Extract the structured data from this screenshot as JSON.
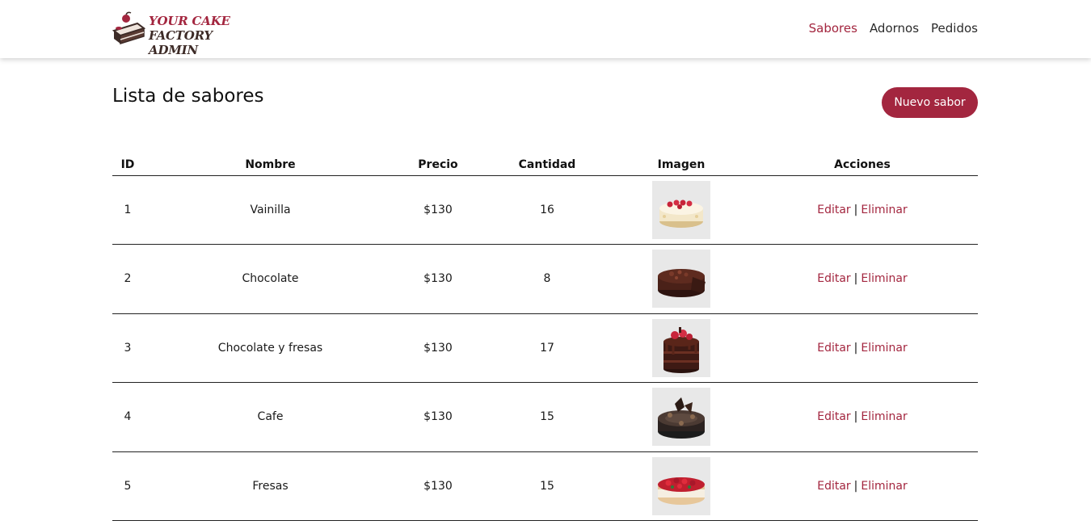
{
  "app": {
    "logo_line1": "YOUR CAKE",
    "logo_line2": "FACTORY ADMIN",
    "brand_color": "#a3263f"
  },
  "nav": {
    "items": [
      {
        "label": "Sabores",
        "active": true
      },
      {
        "label": "Adornos",
        "active": false
      },
      {
        "label": "Pedidos",
        "active": false
      }
    ]
  },
  "page": {
    "title": "Lista de sabores",
    "new_button": "Nuevo sabor"
  },
  "table": {
    "headers": [
      "ID",
      "Nombre",
      "Precio",
      "Cantidad",
      "Imagen",
      "Acciones"
    ],
    "rows": [
      {
        "id": "1",
        "name": "Vainilla",
        "price": "$130",
        "qty": "16",
        "image_icon": "vanilla-cake-image"
      },
      {
        "id": "2",
        "name": "Chocolate",
        "price": "$130",
        "qty": "8",
        "image_icon": "chocolate-cake-image"
      },
      {
        "id": "3",
        "name": "Chocolate y fresas",
        "price": "$130",
        "qty": "17",
        "image_icon": "chocolate-strawberry-cake-image"
      },
      {
        "id": "4",
        "name": "Cafe",
        "price": "$130",
        "qty": "15",
        "image_icon": "coffee-cake-image"
      },
      {
        "id": "5",
        "name": "Fresas",
        "price": "$130",
        "qty": "15",
        "image_icon": "strawberry-cake-image"
      }
    ],
    "edit_label": "Editar",
    "separator": "|",
    "delete_label": "Eliminar"
  }
}
